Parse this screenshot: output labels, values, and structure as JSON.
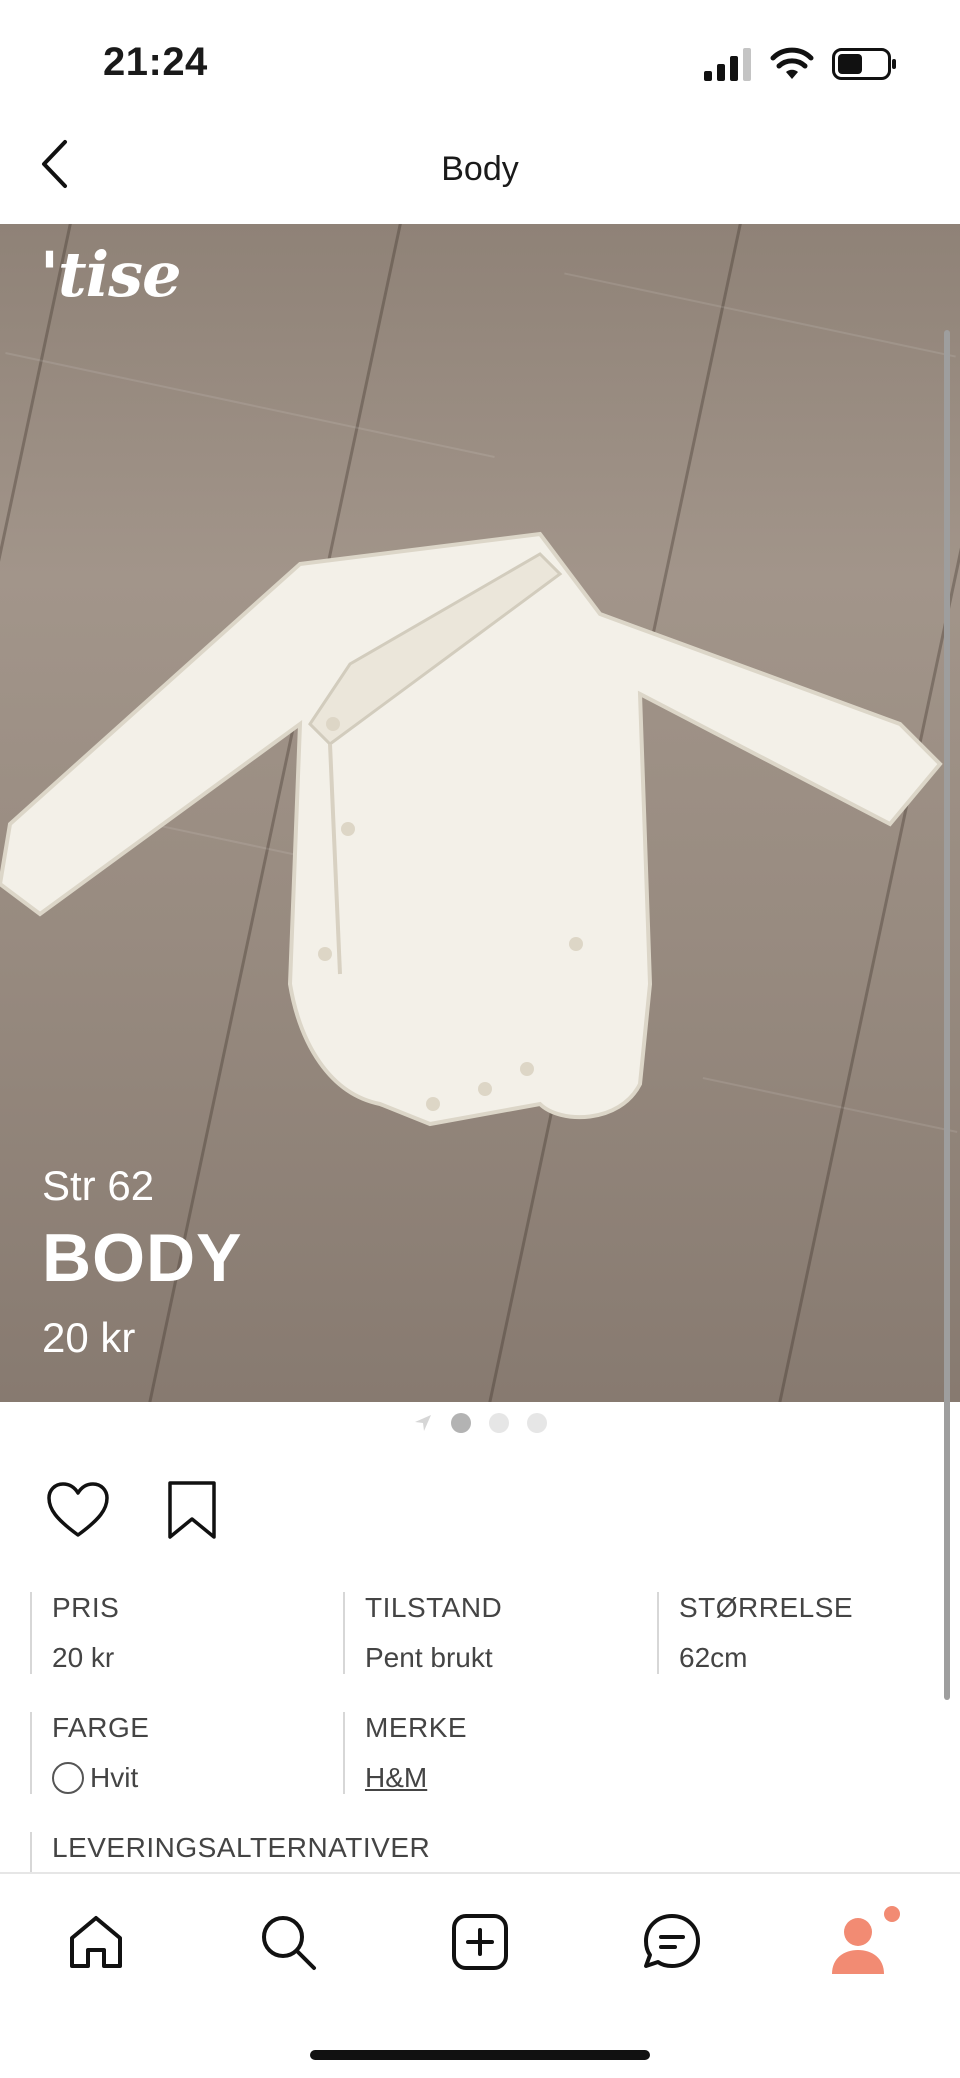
{
  "status_bar": {
    "time": "21:24"
  },
  "header": {
    "title": "Body"
  },
  "hero": {
    "brand": "'tise",
    "size_text": "Str 62",
    "title": "BODY",
    "price": "20 kr",
    "pager": {
      "count": 3,
      "active_index": 1
    }
  },
  "attributes": [
    {
      "label": "PRIS",
      "value": "20 kr"
    },
    {
      "label": "TILSTAND",
      "value": "Pent brukt"
    },
    {
      "label": "STØRRELSE",
      "value": "62cm"
    },
    {
      "label": "FARGE",
      "value": "Hvit",
      "swatch_color": "#ffffff"
    },
    {
      "label": "MERKE",
      "value": "H&M"
    },
    {
      "label": "LEVERINGSALTERNATIVER"
    }
  ],
  "tabbar": {
    "items": [
      "home-icon",
      "search-icon",
      "add-icon",
      "messages-icon",
      "profile-icon"
    ],
    "accent": "#f28b73"
  }
}
